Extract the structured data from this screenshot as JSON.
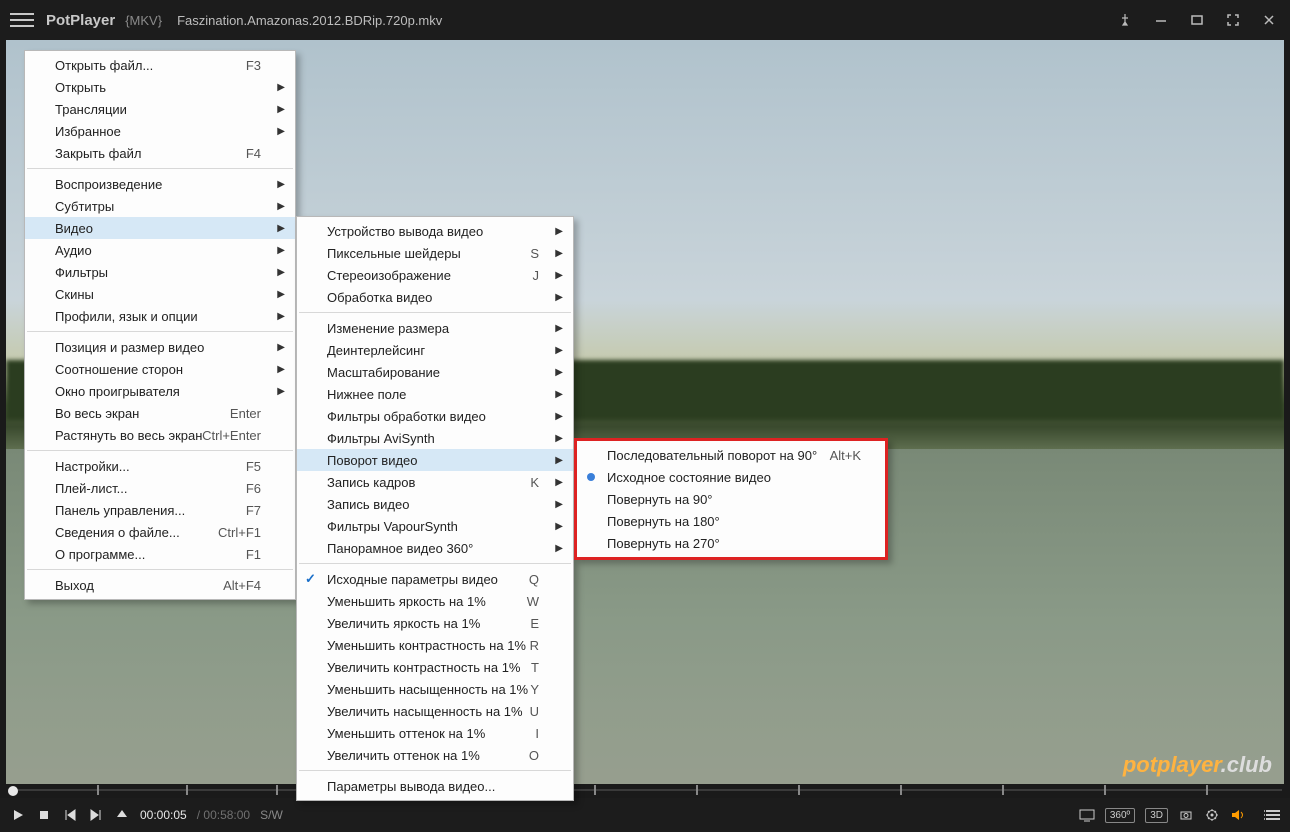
{
  "titlebar": {
    "app": "PotPlayer",
    "format": "{MKV}",
    "filename": "Faszination.Amazonas.2012.BDRip.720p.mkv"
  },
  "watermark": {
    "main": "potplayer",
    "suffix": ".club"
  },
  "controls": {
    "time_current": "00:00:05",
    "time_total": "00:58:00",
    "mode": "S/W",
    "badge_360": "360º",
    "badge_3d": "3D"
  },
  "menu1": {
    "items": [
      {
        "label": "Открыть файл...",
        "shortcut": "F3"
      },
      {
        "label": "Открыть",
        "submenu": true
      },
      {
        "label": "Трансляции",
        "submenu": true
      },
      {
        "label": "Избранное",
        "submenu": true
      },
      {
        "label": "Закрыть файл",
        "shortcut": "F4"
      },
      {
        "sep": true
      },
      {
        "label": "Воспроизведение",
        "submenu": true
      },
      {
        "label": "Субтитры",
        "submenu": true
      },
      {
        "label": "Видео",
        "submenu": true,
        "highlight": true
      },
      {
        "label": "Аудио",
        "submenu": true
      },
      {
        "label": "Фильтры",
        "submenu": true
      },
      {
        "label": "Скины",
        "submenu": true
      },
      {
        "label": "Профили, язык и опции",
        "submenu": true
      },
      {
        "sep": true
      },
      {
        "label": "Позиция и размер видео",
        "submenu": true
      },
      {
        "label": "Соотношение сторон",
        "submenu": true
      },
      {
        "label": "Окно проигрывателя",
        "submenu": true
      },
      {
        "label": "Во весь экран",
        "shortcut": "Enter"
      },
      {
        "label": "Растянуть во весь экран",
        "shortcut": "Ctrl+Enter"
      },
      {
        "sep": true
      },
      {
        "label": "Настройки...",
        "shortcut": "F5"
      },
      {
        "label": "Плей-лист...",
        "shortcut": "F6"
      },
      {
        "label": "Панель управления...",
        "shortcut": "F7"
      },
      {
        "label": "Сведения о файле...",
        "shortcut": "Ctrl+F1"
      },
      {
        "label": "О программе...",
        "shortcut": "F1"
      },
      {
        "sep": true
      },
      {
        "label": "Выход",
        "shortcut": "Alt+F4"
      }
    ]
  },
  "menu2": {
    "items": [
      {
        "label": "Устройство вывода видео",
        "submenu": true
      },
      {
        "label": "Пиксельные шейдеры",
        "shortcut": "S",
        "submenu": true
      },
      {
        "label": "Стереоизображение",
        "shortcut": "J",
        "submenu": true
      },
      {
        "label": "Обработка видео",
        "submenu": true
      },
      {
        "sep": true
      },
      {
        "label": "Изменение размера",
        "submenu": true
      },
      {
        "label": "Деинтерлейсинг",
        "submenu": true
      },
      {
        "label": "Масштабирование",
        "submenu": true
      },
      {
        "label": "Нижнее поле",
        "submenu": true
      },
      {
        "label": "Фильтры обработки видео",
        "submenu": true
      },
      {
        "label": "Фильтры AviSynth",
        "submenu": true
      },
      {
        "label": "Поворот видео",
        "submenu": true,
        "highlight": true
      },
      {
        "label": "Запись кадров",
        "shortcut": "K",
        "submenu": true
      },
      {
        "label": "Запись видео",
        "submenu": true
      },
      {
        "label": "Фильтры VapourSynth",
        "submenu": true
      },
      {
        "label": "Панорамное видео 360°",
        "submenu": true
      },
      {
        "sep": true
      },
      {
        "label": "Исходные параметры видео",
        "shortcut": "Q",
        "check": true
      },
      {
        "label": "Уменьшить яркость на 1%",
        "shortcut": "W"
      },
      {
        "label": "Увеличить яркость на 1%",
        "shortcut": "E"
      },
      {
        "label": "Уменьшить контрастность на 1%",
        "shortcut": "R"
      },
      {
        "label": "Увеличить контрастность на 1%",
        "shortcut": "T"
      },
      {
        "label": "Уменьшить насыщенность на 1%",
        "shortcut": "Y"
      },
      {
        "label": "Увеличить насыщенность на 1%",
        "shortcut": "U"
      },
      {
        "label": "Уменьшить оттенок на 1%",
        "shortcut": "I"
      },
      {
        "label": "Увеличить оттенок на 1%",
        "shortcut": "O"
      },
      {
        "sep": true
      },
      {
        "label": "Параметры вывода видео..."
      }
    ]
  },
  "menu3": {
    "items": [
      {
        "label": "Последовательный поворот на 90°",
        "shortcut": "Alt+K"
      },
      {
        "label": "Исходное состояние видео",
        "radio": true
      },
      {
        "label": "Повернуть на 90°"
      },
      {
        "label": "Повернуть на 180°"
      },
      {
        "label": "Повернуть на 270°"
      }
    ]
  }
}
